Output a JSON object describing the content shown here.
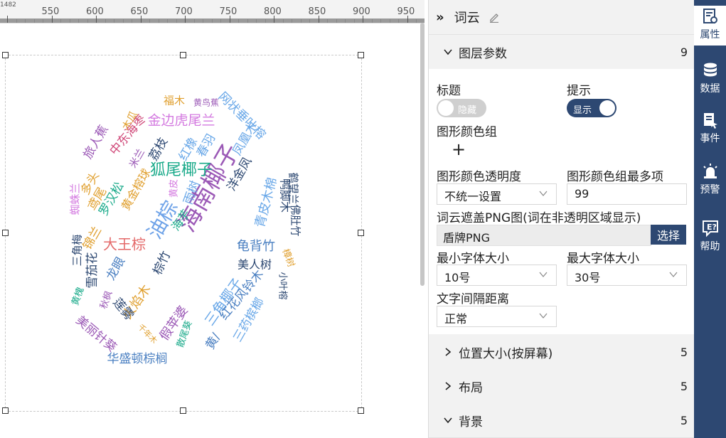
{
  "ruler": {
    "corner": "1482",
    "labels": [
      "550",
      "600",
      "650",
      "700",
      "750",
      "800",
      "850",
      "900",
      "950"
    ]
  },
  "wordcloud": {
    "words": [
      {
        "text": "海南椰子",
        "color": "#9b59b6"
      },
      {
        "text": "油棕",
        "color": "#6fa3e8"
      },
      {
        "text": "狐尾椰子",
        "color": "#1aaa8a"
      },
      {
        "text": "金边虎尾兰",
        "color": "#d47be0"
      },
      {
        "text": "大王棕",
        "color": "#e46a6a"
      },
      {
        "text": "龟背竹",
        "color": "#4a7fc1"
      },
      {
        "text": "网状垂叶榕",
        "color": "#6aa8e8"
      },
      {
        "text": "中东海枣",
        "color": "#d04a7a"
      },
      {
        "text": "旅人蕉",
        "color": "#9b59b6"
      },
      {
        "text": "福木",
        "color": "#e0a030"
      },
      {
        "text": "黄鸟蕉",
        "color": "#9b59b6"
      },
      {
        "text": "荔枝",
        "color": "#2d4872"
      },
      {
        "text": "红橡",
        "color": "#6aa8e8"
      },
      {
        "text": "春羽",
        "color": "#6aa8e8"
      },
      {
        "text": "凤凰木",
        "color": "#6aa8e8"
      },
      {
        "text": "洋金凤",
        "color": "#2d4872"
      },
      {
        "text": "木瓜",
        "color": "#e0a030"
      },
      {
        "text": "米兰",
        "color": "#9b59b6"
      },
      {
        "text": "多头",
        "color": "#e0a030"
      },
      {
        "text": "黄金榕球",
        "color": "#e0a030"
      },
      {
        "text": "罗汉松",
        "color": "#1aaa8a"
      },
      {
        "text": "鸢尾",
        "color": "#e0a030"
      },
      {
        "text": "蜘蛛兰",
        "color": "#d47be0"
      },
      {
        "text": "三角梅",
        "color": "#2d4872"
      },
      {
        "text": "雪茄花",
        "color": "#2d4872"
      },
      {
        "text": "锦兰",
        "color": "#e0a030"
      },
      {
        "text": "雨树",
        "color": "#6aa8e8"
      },
      {
        "text": "黄皮",
        "color": "#d47be0"
      },
      {
        "text": "海芋",
        "color": "#1aaa8a"
      },
      {
        "text": "棕竹",
        "color": "#2d4872"
      },
      {
        "text": "龙眼",
        "color": "#4a7fc1"
      },
      {
        "text": "青皮木棉",
        "color": "#6aa8e8"
      },
      {
        "text": "鸭脚木",
        "color": "#2d4872"
      },
      {
        "text": "鹤望兰",
        "color": "#2d4872"
      },
      {
        "text": "佛肚竹",
        "color": "#2d4872"
      },
      {
        "text": "美人树",
        "color": "#2d4872"
      },
      {
        "text": "樟树",
        "color": "#e0a030"
      },
      {
        "text": "小叶榕",
        "color": "#2d4872"
      },
      {
        "text": "火焰木",
        "color": "#e0a030"
      },
      {
        "text": "秋枫",
        "color": "#9b59b6"
      },
      {
        "text": "黄槐",
        "color": "#1aaa8a"
      },
      {
        "text": "美丽针葵",
        "color": "#9b59b6"
      },
      {
        "text": "莲雾",
        "color": "#2d4872"
      },
      {
        "text": "假苹婆",
        "color": "#9b59b6"
      },
      {
        "text": "千年木",
        "color": "#e0a030"
      },
      {
        "text": "散尾葵",
        "color": "#1aaa8a"
      },
      {
        "text": "三角椰子",
        "color": "#6aa8e8"
      },
      {
        "text": "红花风铃木",
        "color": "#4a7fc1"
      },
      {
        "text": "黄/",
        "color": "#4a7fc1"
      },
      {
        "text": "三药槟榔",
        "color": "#6aa8e8"
      },
      {
        "text": "华盛顿棕榈",
        "color": "#4a7fc1"
      }
    ]
  },
  "panel": {
    "title": "词云",
    "layer_section": {
      "label": "图层参数",
      "count": "9"
    },
    "title_label": "标题",
    "title_toggle": "隐藏",
    "tooltip_label": "提示",
    "tooltip_toggle": "显示",
    "color_group_label": "图形颜色组",
    "add_symbol": "+",
    "opacity_label": "图形颜色透明度",
    "opacity_value": "不统一设置",
    "max_items_label": "图形颜色组最多项",
    "max_items_value": "99",
    "mask_label": "词云遮盖PNG图(词在非透明区域显示)",
    "mask_value": "盾牌PNG",
    "choose_label": "选择",
    "min_font_label": "最小字体大小",
    "min_font_value": "10号",
    "max_font_label": "最大字体大小",
    "max_font_value": "30号",
    "spacing_label": "文字间隔距离",
    "spacing_value": "正常",
    "position_section": {
      "label": "位置大小(按屏幕)",
      "count": "5"
    },
    "layout_section": {
      "label": "布局",
      "count": "5"
    },
    "background_section": {
      "label": "背景",
      "count": "5"
    }
  },
  "iconbar": {
    "items": [
      {
        "label": "属性",
        "icon": "properties-icon"
      },
      {
        "label": "数据",
        "icon": "database-icon"
      },
      {
        "label": "事件",
        "icon": "event-icon"
      },
      {
        "label": "预警",
        "icon": "alarm-icon"
      },
      {
        "label": "帮助",
        "icon": "help-icon"
      }
    ]
  }
}
